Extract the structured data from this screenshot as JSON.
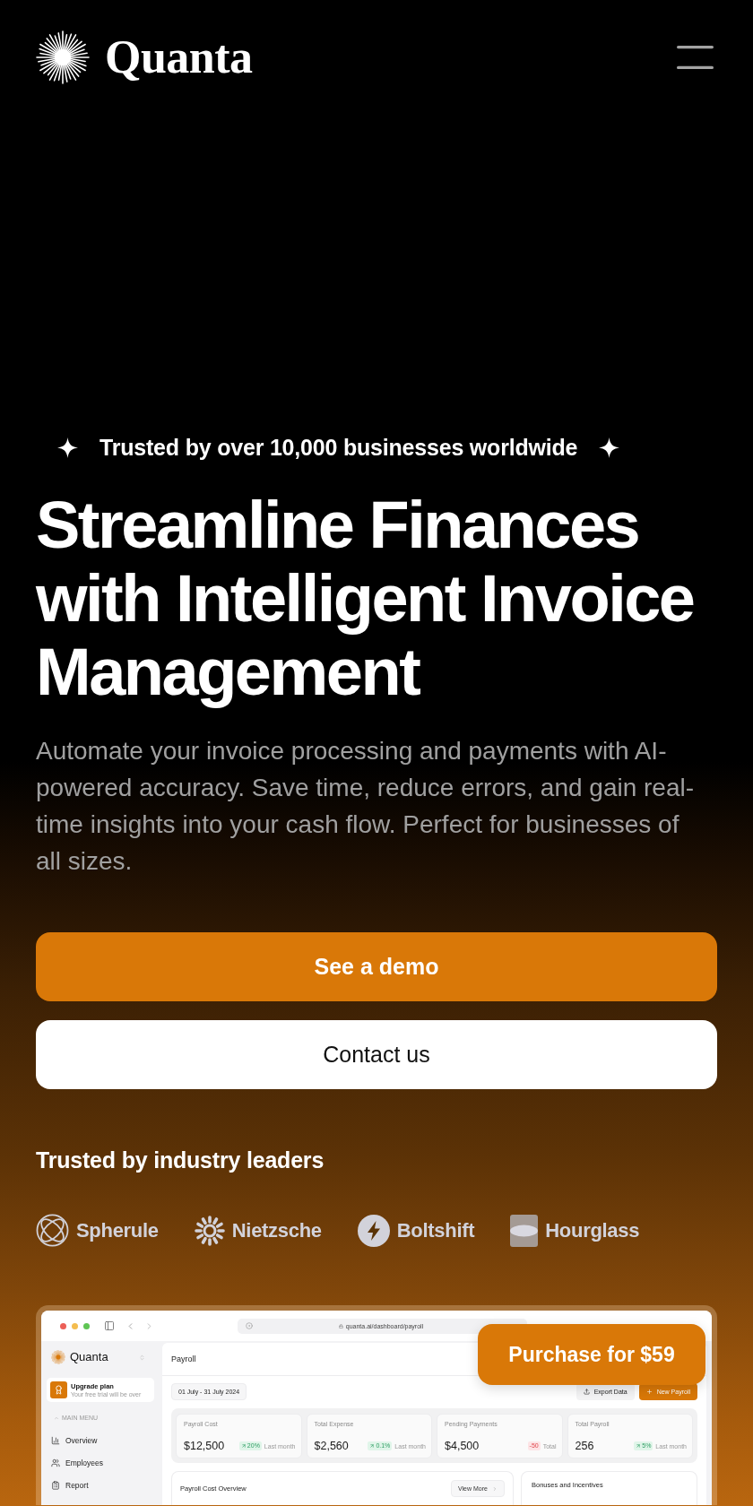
{
  "header": {
    "brand": "Quanta"
  },
  "hero": {
    "badge": "Trusted by over 10,000 businesses worldwide",
    "title": "Streamline Finances with Intelligent Invoice Management",
    "description": "Automate your invoice processing and payments with AI-powered accuracy. Save time, reduce errors, and gain real-time insights into your cash flow. Perfect for businesses of all sizes.",
    "buttons": [
      {
        "label": "See a demo",
        "kind": "primary"
      },
      {
        "label": "Contact us",
        "kind": "secondary"
      }
    ]
  },
  "partners": {
    "heading": "Trusted by industry leaders",
    "logos": [
      {
        "name": "Spherule",
        "kind": "sphere"
      },
      {
        "name": "Nietzsche",
        "kind": "burst"
      },
      {
        "name": "Boltshift",
        "kind": "bolt"
      },
      {
        "name": "Hourglass",
        "kind": "hourglass"
      }
    ]
  },
  "preview": {
    "url": "quanta.ai/dashboard/payroll",
    "sidebar": {
      "brand": "Quanta",
      "upgrade": {
        "title": "Upgrade plan",
        "subtitle": "Your free trial will be over"
      },
      "section": "MAIN MENU",
      "items": [
        {
          "label": "Overview",
          "kind": "chart",
          "selected": false
        },
        {
          "label": "Employees",
          "kind": "users",
          "selected": false
        },
        {
          "label": "Report",
          "kind": "clipboard",
          "selected": false
        }
      ]
    },
    "title": "Payroll",
    "date_range": "01 July - 31 July 2024",
    "actions": [
      {
        "label": "Export Data",
        "kind": "export"
      },
      {
        "label": "New Payroll",
        "kind": "add"
      }
    ],
    "stats": [
      {
        "label": "Payroll Cost",
        "value": "$12,500",
        "change": "20%",
        "kind": "rise",
        "period": "Last month"
      },
      {
        "label": "Total Expense",
        "value": "$2,560",
        "change": "0.1%",
        "kind": "rise",
        "period": "Last month"
      },
      {
        "label": "Pending Payments",
        "value": "$4,500",
        "change": "-50",
        "kind": "fall",
        "period": "Total"
      },
      {
        "label": "Total Payroll",
        "value": "256",
        "change": "5%",
        "kind": "rise",
        "period": "Last month"
      }
    ],
    "panels": [
      {
        "title": "Payroll Cost Overview",
        "action": "View More"
      },
      {
        "title": "Bonuses and Incentives"
      }
    ]
  },
  "purchase": {
    "label": "Purchase for $59"
  }
}
